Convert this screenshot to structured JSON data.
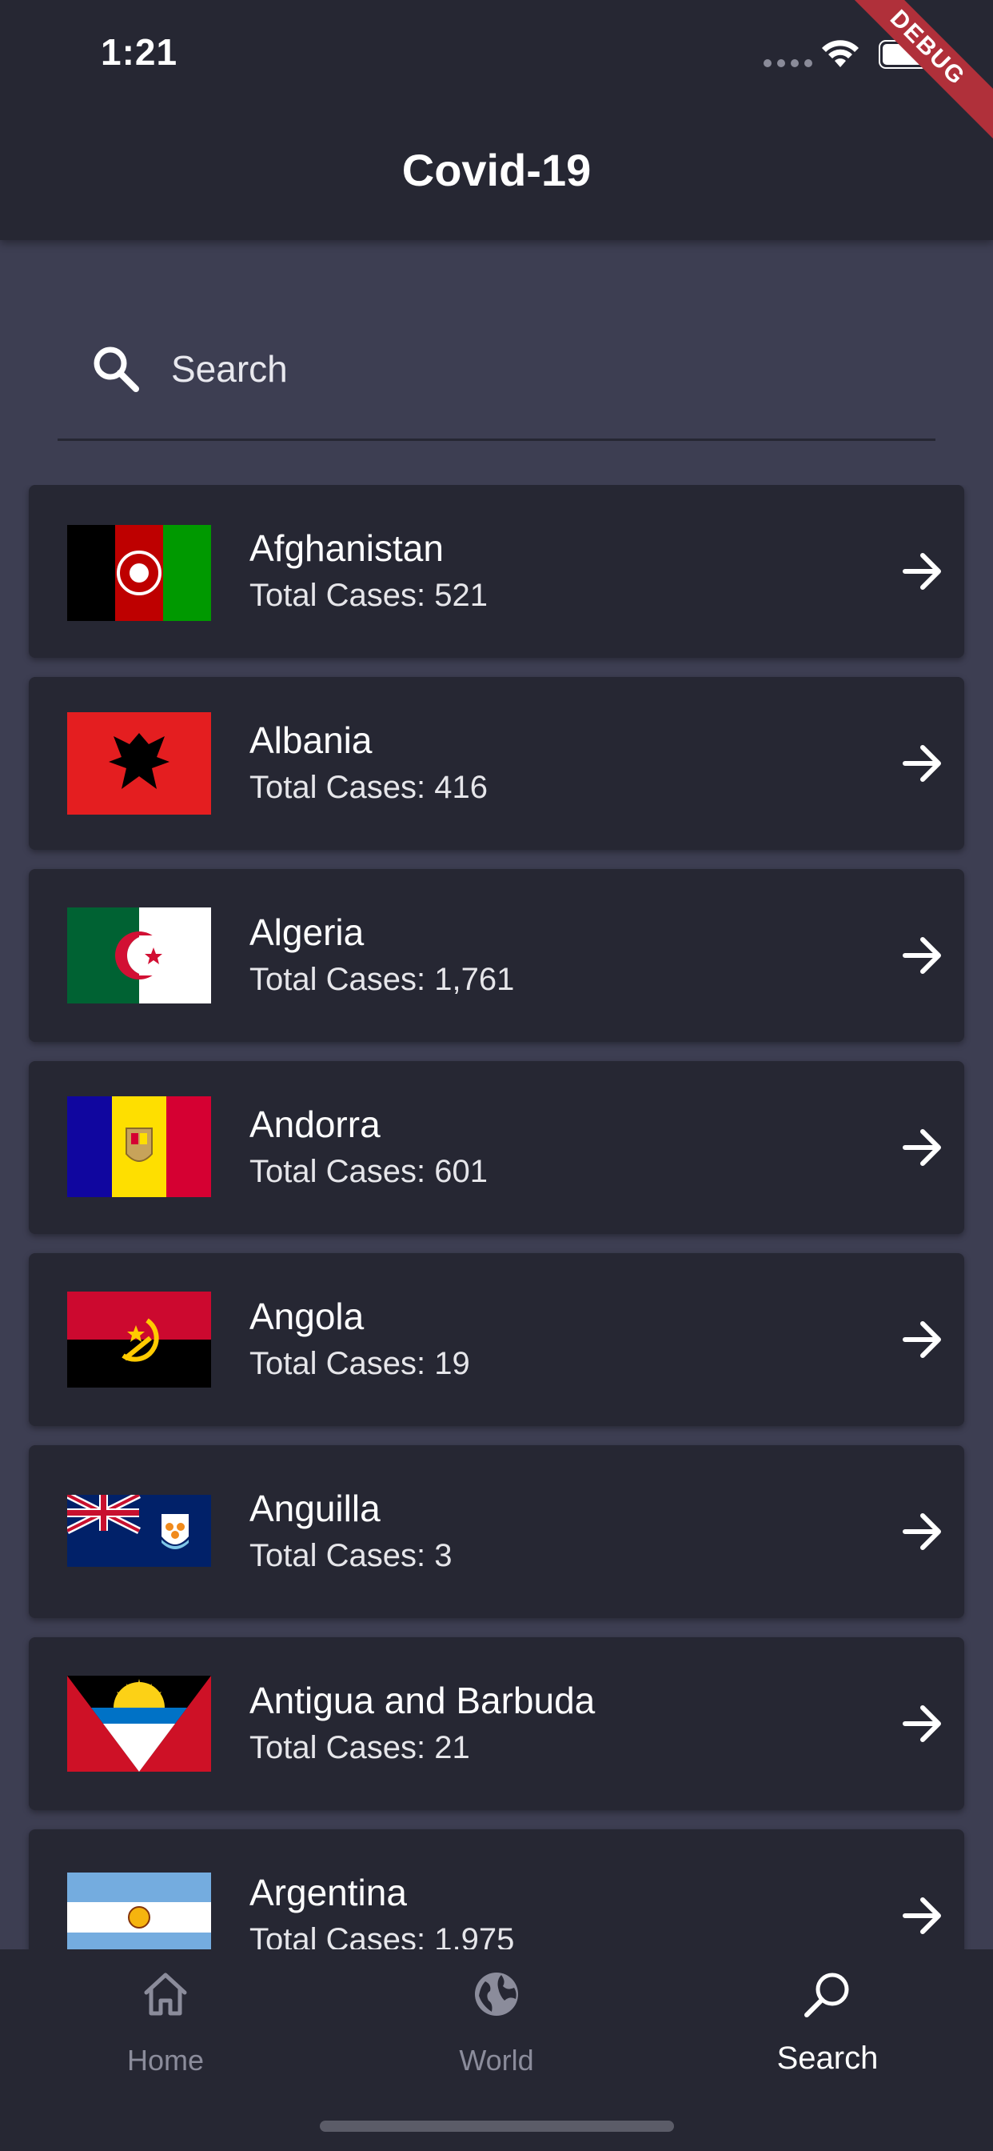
{
  "status_bar": {
    "time": "1:21"
  },
  "debug_banner": "DEBUG",
  "app_bar": {
    "title": "Covid-19"
  },
  "search": {
    "placeholder": "Search",
    "value": ""
  },
  "countries": [
    {
      "name": "Afghanistan",
      "cases_label": "Total Cases: 521"
    },
    {
      "name": "Albania",
      "cases_label": "Total Cases: 416"
    },
    {
      "name": "Algeria",
      "cases_label": "Total Cases: 1,761"
    },
    {
      "name": "Andorra",
      "cases_label": "Total Cases: 601"
    },
    {
      "name": "Angola",
      "cases_label": "Total Cases: 19"
    },
    {
      "name": "Anguilla",
      "cases_label": "Total Cases: 3"
    },
    {
      "name": "Antigua and Barbuda",
      "cases_label": "Total Cases: 21"
    },
    {
      "name": "Argentina",
      "cases_label": "Total Cases: 1,975"
    }
  ],
  "bottom_nav": {
    "items": [
      {
        "label": "Home",
        "icon": "home-icon"
      },
      {
        "label": "World",
        "icon": "globe-icon"
      },
      {
        "label": "Search",
        "icon": "search-icon",
        "active": true
      }
    ]
  },
  "colors": {
    "background": "#3d3e52",
    "surface": "#262733",
    "text": "#ffffff",
    "inactive": "#8b8c9b"
  }
}
